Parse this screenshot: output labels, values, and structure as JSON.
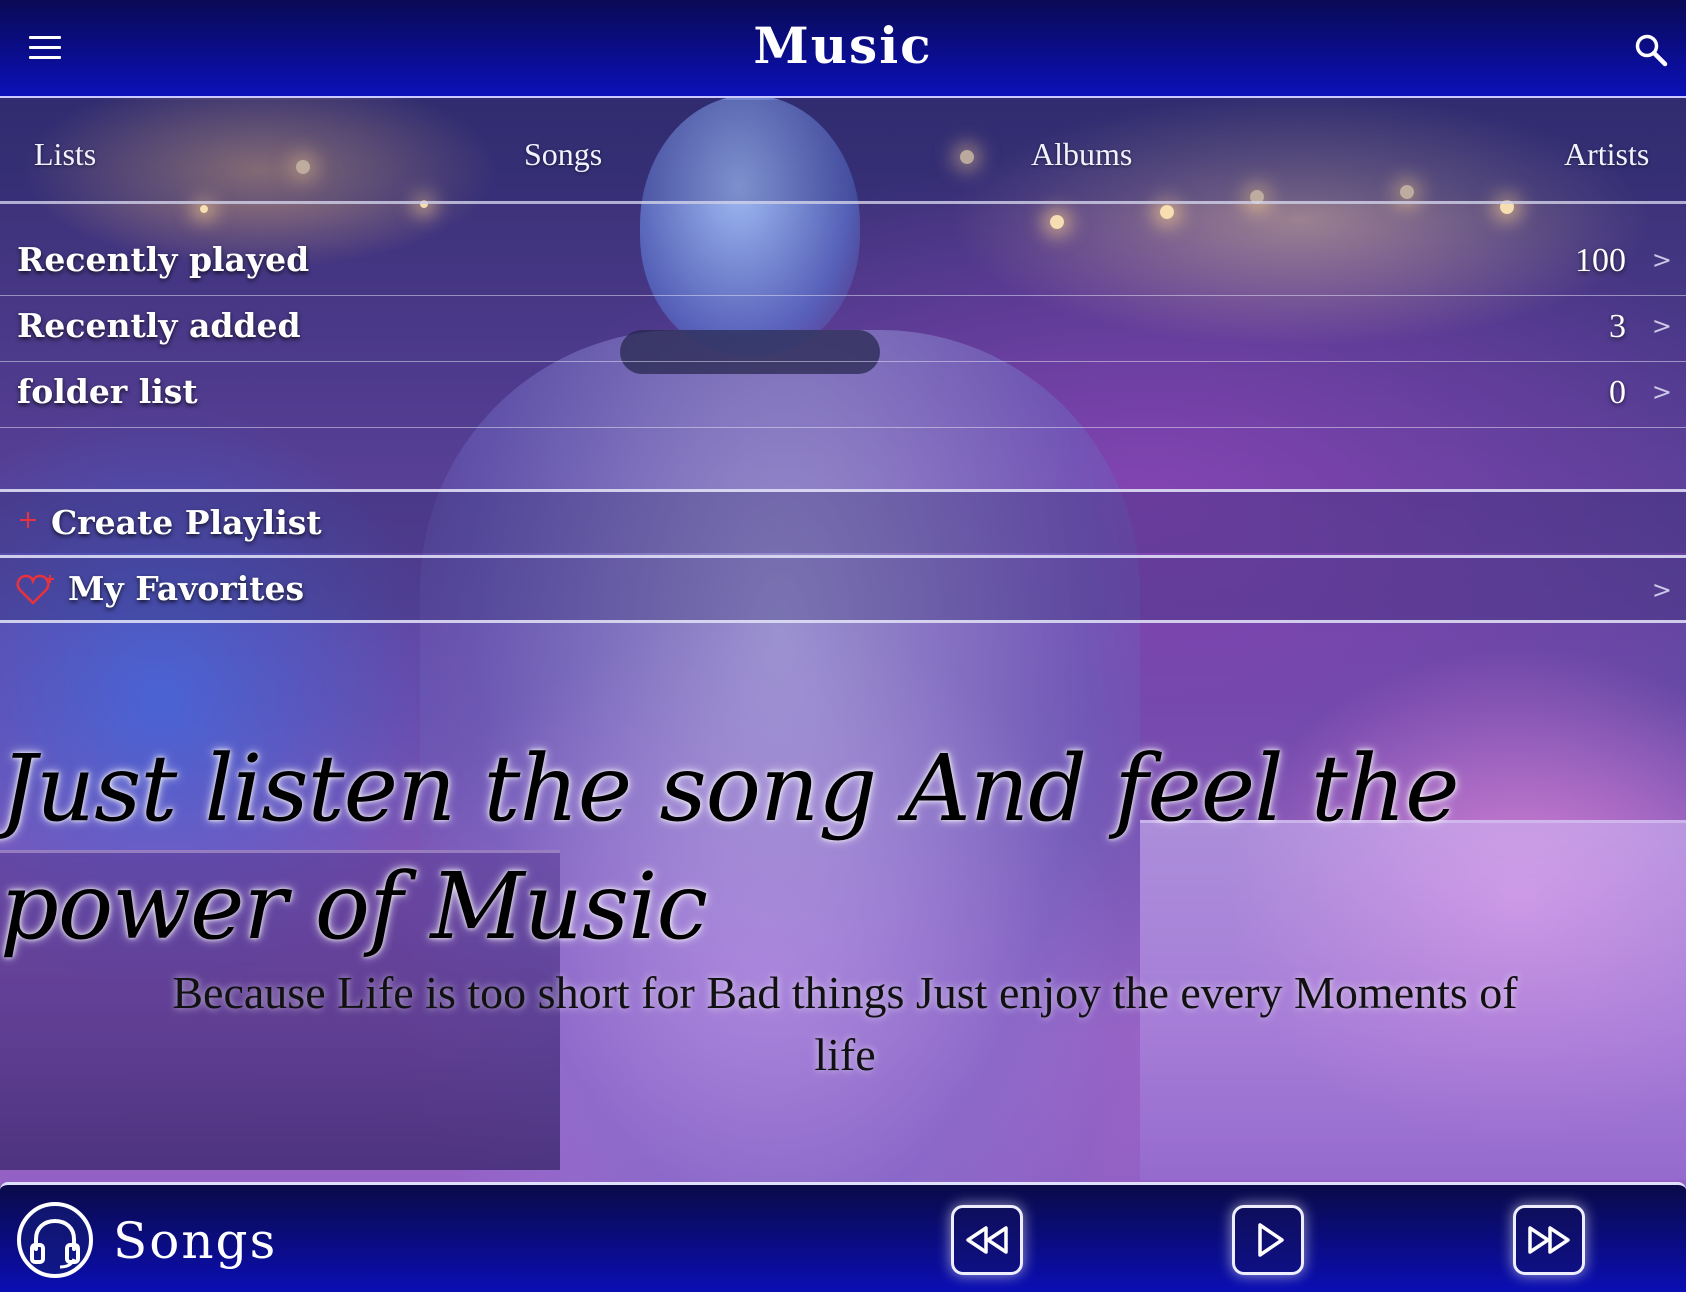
{
  "header": {
    "title": "Music",
    "menu_icon": "hamburger-menu-icon",
    "search_icon": "search-icon"
  },
  "tabs": [
    {
      "label": "Lists"
    },
    {
      "label": "Songs"
    },
    {
      "label": "Albums"
    },
    {
      "label": "Artists"
    }
  ],
  "lists": [
    {
      "label": "Recently played",
      "count": "100"
    },
    {
      "label": "Recently added",
      "count": "3"
    },
    {
      "label": "folder list",
      "count": "0"
    }
  ],
  "chevron": ">",
  "create_playlist": {
    "label": "Create Playlist",
    "icon": "plus-icon"
  },
  "favorites": {
    "label": "My Favorites",
    "icon": "heart-icon"
  },
  "quote": {
    "headline": "Just listen the song And feel the power of Music",
    "subline": "Because Life is too short for Bad things Just enjoy the every Moments of life"
  },
  "player": {
    "title": "Songs",
    "icon": "headphones-icon",
    "controls": [
      "rewind-icon",
      "play-icon",
      "fast-forward-icon"
    ]
  },
  "colors": {
    "bar_dark": "#0a0a55",
    "bar_bright": "#0b10b8",
    "accent_red": "#e8323c"
  }
}
